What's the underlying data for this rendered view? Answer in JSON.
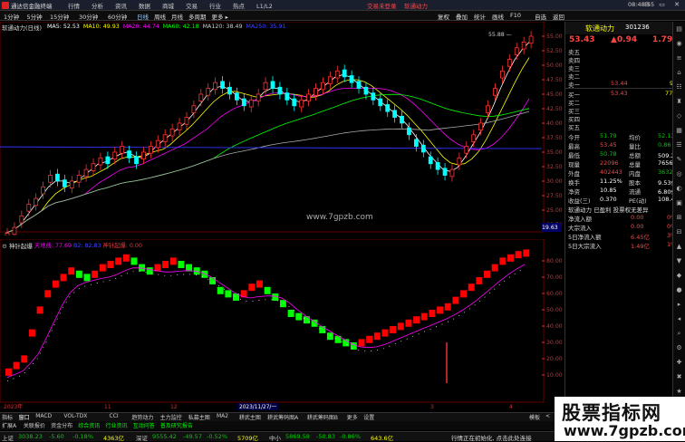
{
  "app": {
    "title": "通达信金融终端",
    "menus": [
      "行情",
      "分析",
      "资讯",
      "数据",
      "商城",
      "交易",
      "行业",
      "热点",
      "L1/L2"
    ],
    "ad1": "交易未登录",
    "ad2": "软通动力",
    "clock": "08:48:55",
    "window_controls": "⊟ ▭ ✕"
  },
  "toolbar": {
    "periods": [
      "1分钟",
      "5分钟",
      "15分钟",
      "30分钟",
      "60分钟",
      "日线",
      "周线",
      "月线",
      "多周期",
      "更多 ▸"
    ],
    "right": [
      "复权",
      "叠加",
      "统计",
      "画线",
      "F10",
      "自选",
      "返回"
    ]
  },
  "main": {
    "stock_label": "软通动力(日线)",
    "ma": [
      {
        "label": "MA5: 52.53",
        "color": "#ffffff"
      },
      {
        "label": "MA10: 49.93",
        "color": "#ffff00"
      },
      {
        "label": "MA20: 44.74",
        "color": "#ff00ff"
      },
      {
        "label": "MA60: 42.18",
        "color": "#00ff00"
      },
      {
        "label": "MA120: 38.49",
        "color": "#cccccc"
      },
      {
        "label": "MA250: 35.91",
        "color": "#4444ff"
      }
    ],
    "y_ticks": [
      "55.00",
      "52.50",
      "50.00",
      "47.50",
      "45.00",
      "42.50",
      "40.00",
      "37.50",
      "35.00",
      "32.50",
      "30.00",
      "27.50",
      "25.00",
      "22.50"
    ],
    "high_label": "55.88",
    "low_label": "19.63",
    "watermark": "www.7gpzb.com"
  },
  "indicator": {
    "name": "神针起爆",
    "sub": [
      {
        "label": "天地线: 77.69",
        "color": "#ff00ff"
      },
      {
        "label": "B2: 82.83",
        "color": "#4444ff"
      }
    ],
    "signal": "神针起爆: 0.00",
    "signal_color": "#ff3333",
    "y_ticks": [
      "80.00",
      "70.00",
      "60.00",
      "50.00",
      "40.00",
      "30.00",
      "20.00",
      "10.00"
    ],
    "x_labels": [
      "2023年",
      "11",
      "12",
      "3",
      "4"
    ],
    "cursor_date": "2023/11/27/一",
    "bars_red": [
      14,
      18,
      22,
      38,
      52,
      62,
      68,
      72,
      76,
      74,
      72,
      74,
      78,
      80,
      82,
      84,
      82,
      78,
      76,
      78,
      80,
      82,
      80,
      78,
      76,
      74,
      70,
      64,
      62,
      60,
      62,
      66,
      68,
      64,
      60,
      56,
      50,
      48,
      46,
      44,
      40,
      36,
      34,
      32,
      30,
      32,
      34,
      36,
      38,
      40,
      42,
      44,
      46,
      48,
      50,
      52,
      54,
      58,
      62,
      66,
      70,
      74,
      78,
      82,
      84,
      86,
      87
    ],
    "spark": {
      "x": 493,
      "from": 5,
      "to": 30
    }
  },
  "chart_data": [
    {
      "type": "candlestick",
      "title": "软通动力(日线)",
      "ylim": [
        19.63,
        55.88
      ],
      "series": [
        {
          "name": "MA5",
          "values": [
            52.53
          ]
        },
        {
          "name": "MA10",
          "values": [
            49.93
          ]
        },
        {
          "name": "MA20",
          "values": [
            44.74
          ]
        },
        {
          "name": "MA60",
          "values": [
            42.18
          ]
        },
        {
          "name": "MA120",
          "values": [
            38.49
          ]
        },
        {
          "name": "MA250",
          "values": [
            35.91
          ]
        }
      ],
      "extremes": {
        "high": 55.88,
        "low": 19.63
      },
      "close_path": [
        21,
        22,
        24,
        26,
        27,
        29,
        31,
        30,
        29,
        30,
        31,
        32,
        33,
        34,
        33,
        35,
        36,
        34,
        33,
        35,
        36,
        37,
        38,
        39,
        40,
        41,
        43,
        45,
        46,
        47,
        46,
        45,
        44,
        43,
        44,
        45,
        47,
        46,
        45,
        44,
        43,
        44,
        45,
        46,
        47,
        48,
        49,
        48,
        47,
        46,
        45,
        44,
        43,
        42,
        41,
        40,
        38,
        36,
        35,
        33,
        32,
        31,
        32,
        34,
        36,
        38,
        40,
        43,
        46,
        49,
        51,
        53,
        54,
        55
      ]
    },
    {
      "type": "bar",
      "title": "神针起爆",
      "ylim": [
        0,
        90
      ],
      "series": [
        {
          "name": "天地线",
          "values": [
            77.69
          ]
        },
        {
          "name": "B2",
          "values": [
            82.83
          ]
        }
      ]
    }
  ],
  "quote": {
    "name": "软通动力",
    "code": "301236",
    "price": "53.43",
    "change": "▲0.94",
    "pct": "1.79%",
    "asks": [
      {
        "l": "卖五",
        "p": "",
        "v": ""
      },
      {
        "l": "卖四",
        "p": "",
        "v": ""
      },
      {
        "l": "卖三",
        "p": "",
        "v": ""
      },
      {
        "l": "卖二",
        "p": "",
        "v": ""
      },
      {
        "l": "卖一",
        "p": "53.44",
        "v": "93"
      }
    ],
    "bids": [
      {
        "l": "买一",
        "p": "53.43",
        "v": "776"
      },
      {
        "l": "买二",
        "p": "",
        "v": ""
      },
      {
        "l": "买三",
        "p": "",
        "v": ""
      },
      {
        "l": "买四",
        "p": "",
        "v": ""
      },
      {
        "l": "买五",
        "p": "",
        "v": ""
      }
    ],
    "stats": [
      {
        "l": "今开",
        "v": "51.79",
        "c": "#0c0",
        "l2": "均价",
        "v2": "52.13",
        "c2": "#0c0"
      },
      {
        "l": "最高",
        "v": "53.45",
        "c": "#f44",
        "l2": "量比",
        "v2": "0.86",
        "c2": "#0c0"
      },
      {
        "l": "最低",
        "v": "50.78",
        "c": "#0c0",
        "l2": "总额",
        "v2": "509.2亿",
        "c2": "#fff"
      },
      {
        "l": "现量",
        "v": "22096",
        "c": "#f44",
        "l2": "总量",
        "v2": "765671",
        "c2": "#fff"
      },
      {
        "l": "外盘",
        "v": "402443",
        "c": "#f44",
        "l2": "内盘",
        "v2": "363228",
        "c2": "#0c0"
      },
      {
        "l": "换手",
        "v": "11.25%",
        "c": "#fff",
        "l2": "股本",
        "v2": "9.53亿",
        "c2": "#fff"
      },
      {
        "l": "净资",
        "v": "10.85",
        "c": "#fff",
        "l2": "流通",
        "v2": "6.80亿",
        "c2": "#fff"
      },
      {
        "l": "收益(三)",
        "v": "0.370",
        "c": "#fff",
        "l2": "PE(动)",
        "v2": "108.4",
        "c2": "#fff"
      }
    ],
    "tags": "软通动力  已盈利  投票权无差异",
    "flows": [
      {
        "l": "净流入额",
        "v1": "0.00",
        "v2": "0%"
      },
      {
        "l": "大宗流入",
        "v1": "0.00",
        "v2": "0%"
      },
      {
        "l": "5日净流入额",
        "v1": "6.45亿",
        "v2": "3%"
      },
      {
        "l": "5日大宗流入",
        "v1": "1.49亿",
        "v2": "1%"
      }
    ]
  },
  "tabs": [
    "指标",
    "窗口",
    "MACD",
    "VOL-TDX",
    "CCI",
    "趋势动力",
    "主力监控",
    "私募主图",
    "MA2",
    "耕武主图",
    "耕武筹码图A",
    "耕武筹码图B",
    "更多",
    "设置"
  ],
  "tabs_right": [
    "模板",
    "<",
    ">"
  ],
  "tabs2": [
    "扩展A",
    "关联报价",
    "资金分布",
    "综合资讯",
    "行业资讯",
    "互动问答",
    "普及研究报告"
  ],
  "status": {
    "sh": {
      "label": "上证",
      "v": "3038.23",
      "c": "-5.60",
      "p": "-0.18%",
      "a": "4363亿"
    },
    "sz": {
      "label": "深证",
      "v": "9555.42",
      "c": "-49.57",
      "p": "-0.52%",
      "a": "5709亿"
    },
    "zx": {
      "label": "中小",
      "v": "5869.58",
      "c": "-50.83",
      "p": "-0.86%",
      "a": "643.6亿"
    },
    "msg": "行情正在初始化, 点击此处连接"
  },
  "brand": {
    "big": "股票指标网",
    "url": "www.7gpzb.com"
  }
}
